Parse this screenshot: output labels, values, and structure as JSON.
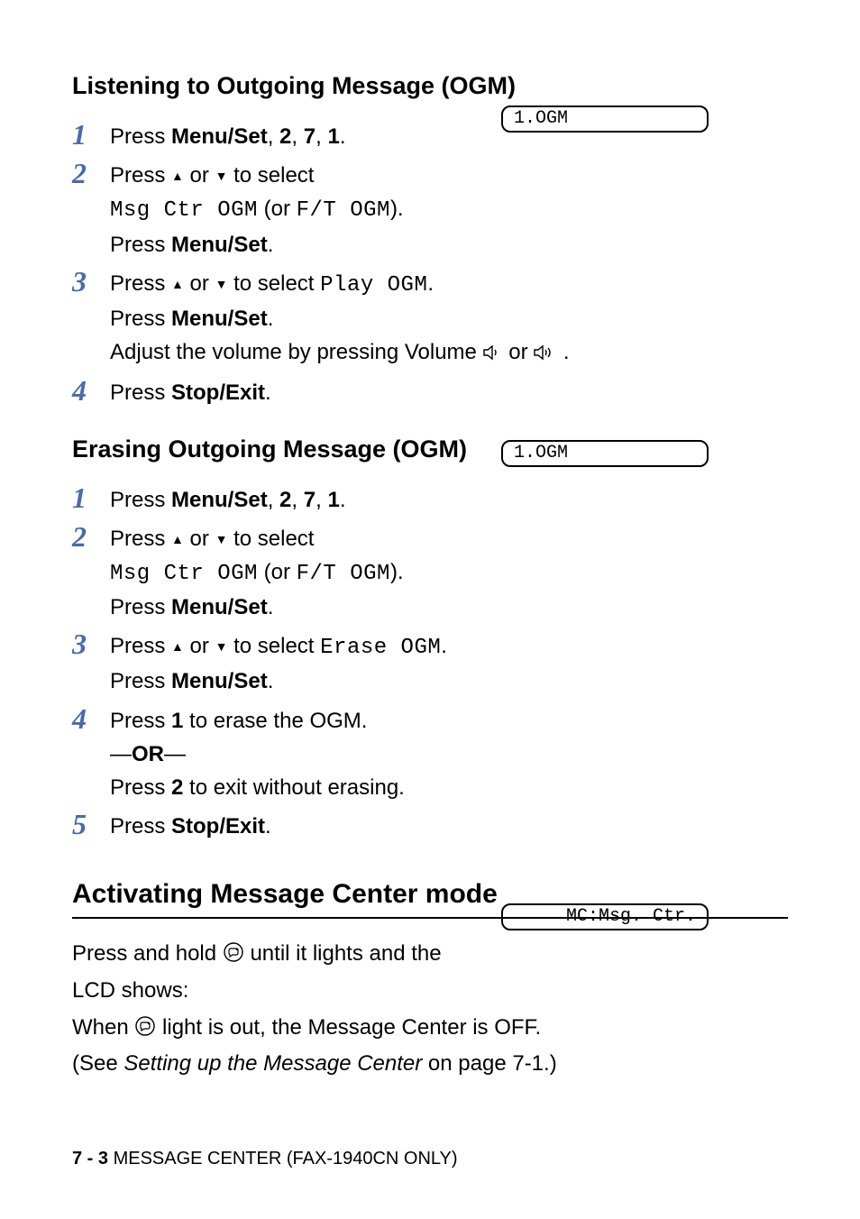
{
  "section1": {
    "title": "Listening to Outgoing Message (OGM)",
    "lcd": "1.OGM",
    "steps": {
      "s1": {
        "t1": "Press ",
        "b1": "Menu/Set",
        "t2": ", ",
        "b2": "2",
        "t3": ", ",
        "b3": "7",
        "t4": ", ",
        "b4": "1",
        "t5": "."
      },
      "s2": {
        "t1": "Press ",
        "t2": " or ",
        "t3": " to select",
        "m1": "Msg Ctr OGM",
        "t4": " (or ",
        "m2": "F/T OGM",
        "t5": ").",
        "t6": "Press ",
        "b1": "Menu/Set",
        "t7": "."
      },
      "s3": {
        "t1": "Press ",
        "t2": " or ",
        "t3": " to select ",
        "m1": "Play OGM",
        "t4": ".",
        "t5": "Press ",
        "b1": "Menu/Set",
        "t6": ".",
        "t7": "Adjust the volume by pressing Volume ",
        "t8": " or ",
        "t9": " ."
      },
      "s4": {
        "t1": "Press ",
        "b1": "Stop/Exit",
        "t2": "."
      }
    }
  },
  "section2": {
    "title": "Erasing Outgoing Message (OGM)",
    "lcd": "1.OGM",
    "steps": {
      "s1": {
        "t1": "Press ",
        "b1": "Menu/Set",
        "t2": ", ",
        "b2": "2",
        "t3": ", ",
        "b3": "7",
        "t4": ", ",
        "b4": "1",
        "t5": "."
      },
      "s2": {
        "t1": "Press ",
        "t2": " or ",
        "t3": " to select",
        "m1": "Msg Ctr OGM",
        "t4": " (or ",
        "m2": "F/T OGM",
        "t5": ").",
        "t6": "Press ",
        "b1": "Menu/Set",
        "t7": "."
      },
      "s3": {
        "t1": "Press ",
        "t2": " or ",
        "t3": " to select ",
        "m1": "Erase OGM",
        "t4": ".",
        "t5": "Press ",
        "b1": "Menu/Set",
        "t6": "."
      },
      "s4": {
        "t1": "Press ",
        "b1": "1",
        "t2": " to erase the OGM.",
        "or1": "—",
        "orb": "OR",
        "or2": "—",
        "t3": "Press ",
        "b2": "2",
        "t4": " to exit without erasing."
      },
      "s5": {
        "t1": "Press ",
        "b1": "Stop/Exit",
        "t2": "."
      }
    }
  },
  "section3": {
    "title": "Activating Message Center mode",
    "lcd": "MC:Msg. Ctr.",
    "p1": {
      "t1": "Press and hold ",
      "t2": " until it lights and the",
      "t3": "LCD shows:"
    },
    "p2": {
      "t1": "When ",
      "t2": " light is out, the Message Center is OFF."
    },
    "p3": {
      "t1": "(See ",
      "i1": "Setting up the Message Center",
      "t2": " on page 7-1.)"
    }
  },
  "footer": {
    "page": "7 - 3",
    "title": "   MESSAGE CENTER (FAX-1940CN ONLY)"
  },
  "nums": {
    "n1": "1",
    "n2": "2",
    "n3": "3",
    "n4": "4",
    "n5": "5"
  }
}
